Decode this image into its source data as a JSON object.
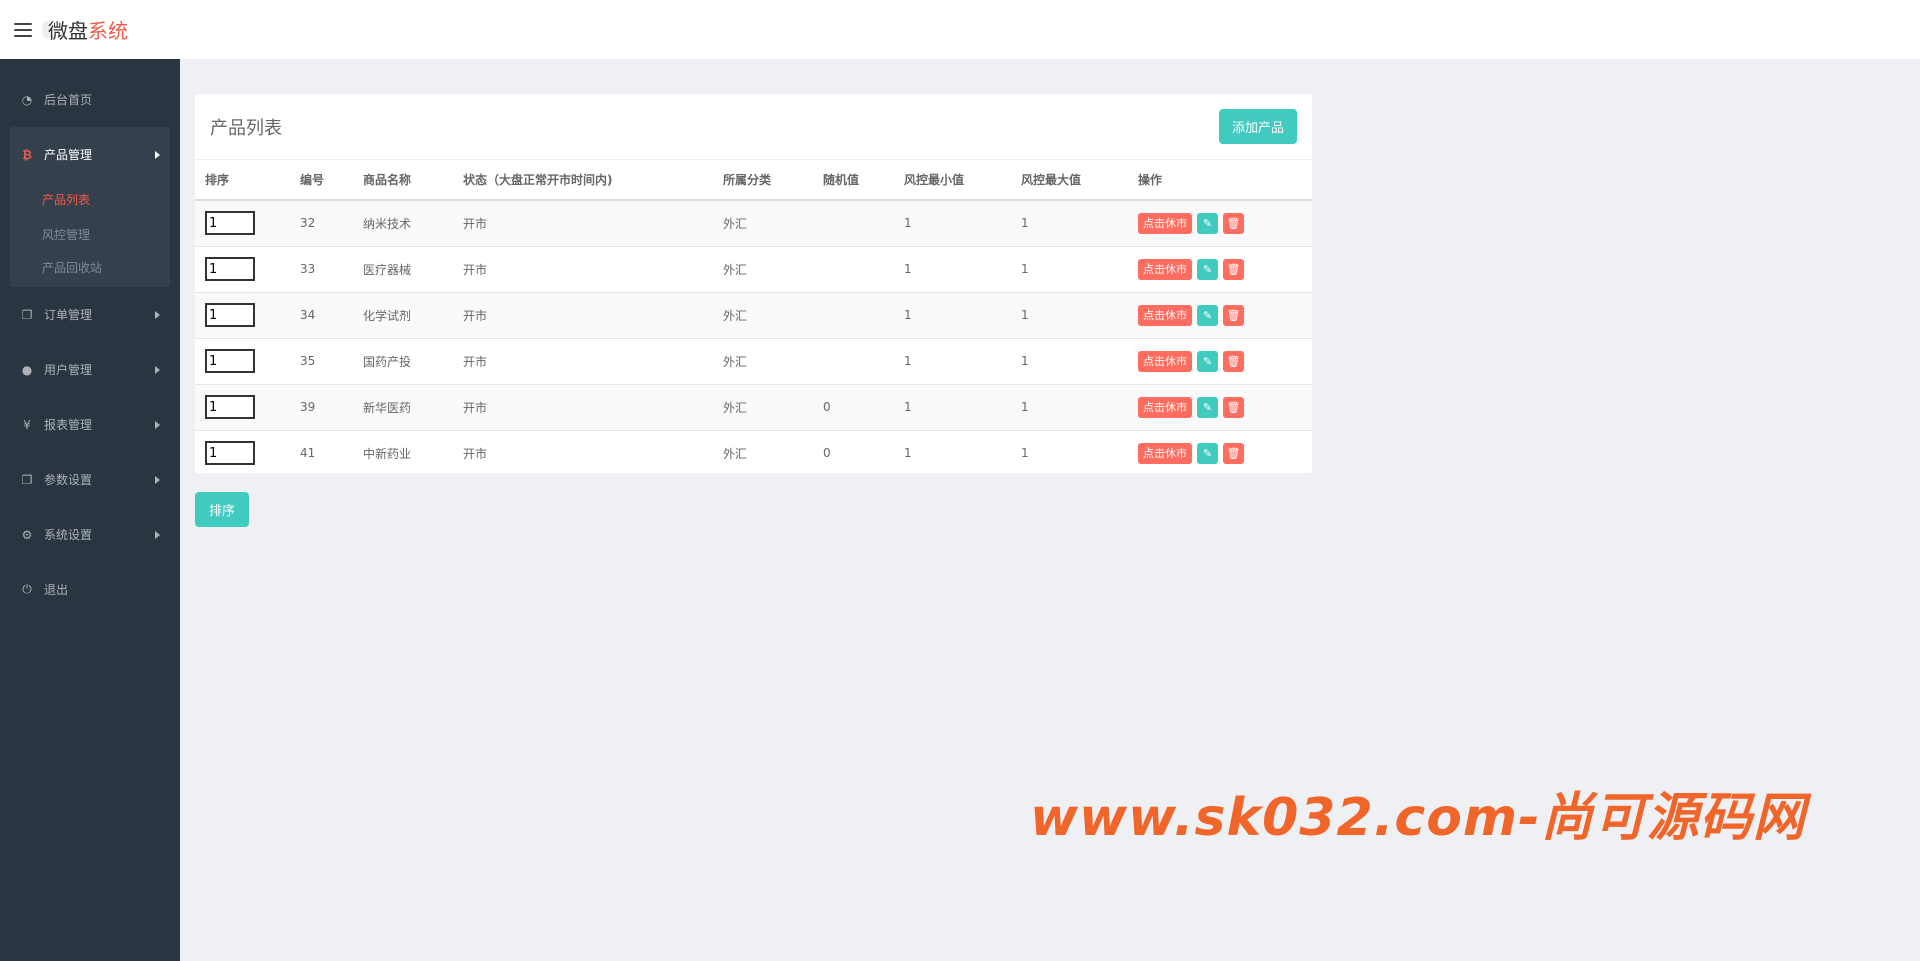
{
  "header": {
    "brand_part1": "微盘",
    "brand_part2": "系统"
  },
  "sidebar": {
    "items": [
      {
        "label": "后台首页",
        "icon": "dashboard-icon"
      },
      {
        "label": "产品管理",
        "icon": "bitcoin-icon",
        "expanded": true,
        "children": [
          {
            "label": "产品列表",
            "active": true
          },
          {
            "label": "风控管理"
          },
          {
            "label": "产品回收站"
          }
        ]
      },
      {
        "label": "订单管理",
        "icon": "copy-icon"
      },
      {
        "label": "用户管理",
        "icon": "user-icon"
      },
      {
        "label": "报表管理",
        "icon": "yen-icon"
      },
      {
        "label": "参数设置",
        "icon": "copy-icon"
      },
      {
        "label": "系统设置",
        "icon": "gears-icon"
      },
      {
        "label": "退出",
        "icon": "power-icon"
      }
    ]
  },
  "panel": {
    "title": "产品列表",
    "add_button": "添加产品",
    "columns": [
      "排序",
      "编号",
      "商品名称",
      "状态（大盘正常开市时间内)",
      "所属分类",
      "随机值",
      "风控最小值",
      "风控最大值",
      "操作"
    ],
    "rows": [
      {
        "sort": "1",
        "id": "32",
        "name": "纳米技术",
        "status": "开市",
        "category": "外汇",
        "random": "",
        "min": "1",
        "max": "1",
        "action": "点击休市"
      },
      {
        "sort": "1",
        "id": "33",
        "name": "医疗器械",
        "status": "开市",
        "category": "外汇",
        "random": "",
        "min": "1",
        "max": "1",
        "action": "点击休市"
      },
      {
        "sort": "1",
        "id": "34",
        "name": "化学试剂",
        "status": "开市",
        "category": "外汇",
        "random": "",
        "min": "1",
        "max": "1",
        "action": "点击休市"
      },
      {
        "sort": "1",
        "id": "35",
        "name": "国药产投",
        "status": "开市",
        "category": "外汇",
        "random": "",
        "min": "1",
        "max": "1",
        "action": "点击休市"
      },
      {
        "sort": "1",
        "id": "39",
        "name": "新华医药",
        "status": "开市",
        "category": "外汇",
        "random": "0",
        "min": "1",
        "max": "1",
        "action": "点击休市"
      },
      {
        "sort": "1",
        "id": "41",
        "name": "中新药业",
        "status": "开市",
        "category": "外汇",
        "random": "0",
        "min": "1",
        "max": "1",
        "action": "点击休市"
      }
    ],
    "sort_button": "排序"
  },
  "watermark": "www.sk032.com-尚可源码网",
  "colors": {
    "accent_teal": "#41cac0",
    "accent_red": "#ff6c60",
    "sidebar_bg": "#2a3542",
    "watermark": "#f0652a"
  }
}
